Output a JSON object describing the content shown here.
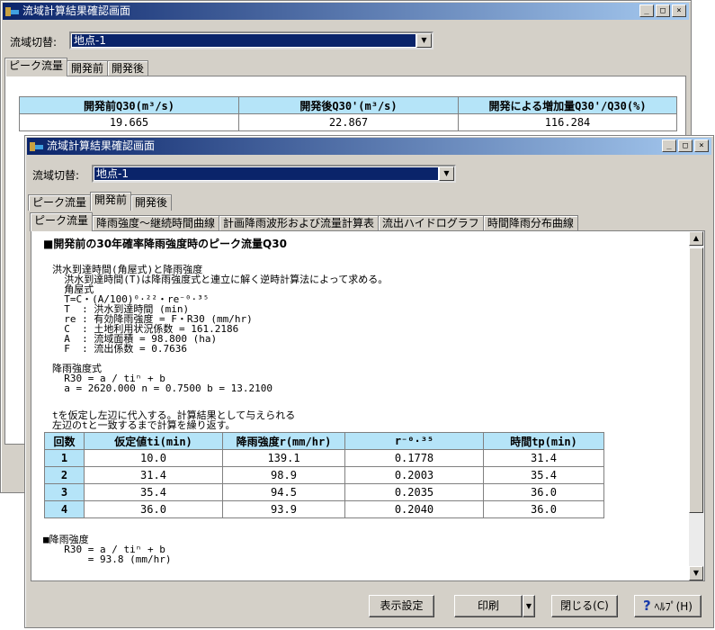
{
  "back": {
    "title": "流域計算結果確認画面",
    "switch_label": "流域切替:",
    "switch_value": "地点-1",
    "tabs": [
      "ピーク流量",
      "開発前",
      "開発後"
    ],
    "table": {
      "headers": [
        "開発前Q30(m³/s)",
        "開発後Q30'(m³/s)",
        "開発による増加量Q30'/Q30(%)"
      ],
      "values": [
        "19.665",
        "22.867",
        "116.284"
      ]
    }
  },
  "front": {
    "title": "流域計算結果確認画面",
    "switch_label": "流域切替:",
    "switch_value": "地点-1",
    "tabs": [
      "ピーク流量",
      "開発前",
      "開発後"
    ],
    "subtabs": [
      "ピーク流量",
      "降雨強度～継続時間曲線",
      "計画降雨波形および流量計算表",
      "流出ハイドログラフ",
      "時間降雨分布曲線"
    ],
    "heading": "■開発前の30年確率降雨強度時のピーク流量Q30",
    "lines1": [
      "洪水到達時間(角屋式)と降雨強度",
      "  洪水到達時間(T)は降雨強度式と連立に解く逆時計算法によって求める。",
      "  角屋式"
    ],
    "formula": "  T=C・(A/100)⁰·²²・re⁻⁰·³⁵",
    "lines2": [
      "  T  : 洪水到達時間 (min)",
      "  re : 有効降雨強度 = F・R30 (mm/hr)",
      "  C  : 土地利用状況係数 = 161.2186",
      "  A  : 流域面積 = 98.800 (ha)",
      "  F  : 流出係数 = 0.7636"
    ],
    "lines3": [
      "降雨強度式",
      "  R30 = a / tiⁿ + b",
      "  a = 2620.000 n = 0.7500 b = 13.2100"
    ],
    "lines4": [
      "tを仮定し左辺に代入する。計算結果として与えられる",
      "左辺のtと一致するまで計算を繰り返す。"
    ],
    "table": {
      "headers": [
        "回数",
        "仮定値ti(min)",
        "降雨強度r(mm/hr)",
        "r⁻⁰·³⁵",
        "時間tp(min)"
      ],
      "rows": [
        [
          "1",
          "10.0",
          "139.1",
          "0.1778",
          "31.4"
        ],
        [
          "2",
          "31.4",
          "98.9",
          "0.2003",
          "35.4"
        ],
        [
          "3",
          "35.4",
          "94.5",
          "0.2035",
          "36.0"
        ],
        [
          "4",
          "36.0",
          "93.9",
          "0.2040",
          "36.0"
        ]
      ]
    },
    "lines5": [
      "■降雨強度",
      "  R30 = a / tiⁿ + b",
      "      = 93.8 (mm/hr)"
    ],
    "buttons": {
      "display": "表示設定",
      "print": "印刷",
      "close": "閉じる(C)",
      "help": "ﾍﾙﾌﾟ(H)"
    }
  }
}
